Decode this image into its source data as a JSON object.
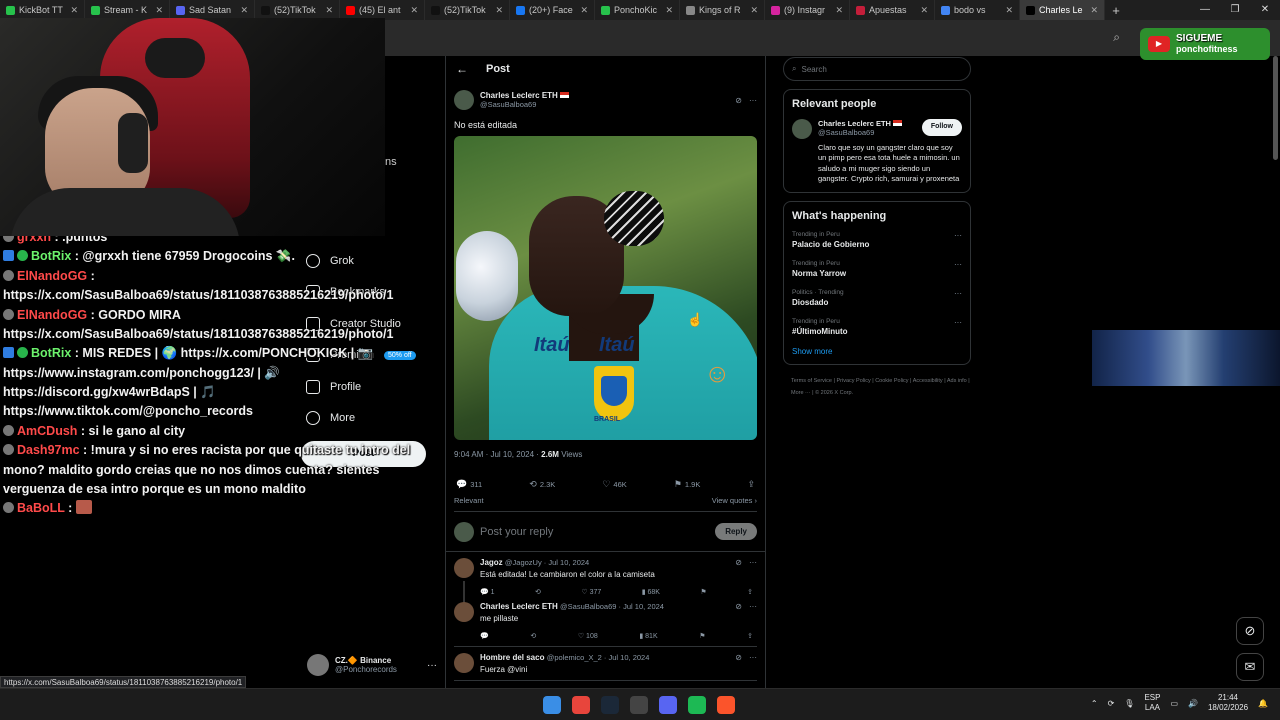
{
  "browser": {
    "tabs": [
      {
        "label": "KickBot TT",
        "color": "#27c24c"
      },
      {
        "label": "Stream - K",
        "color": "#27c24c"
      },
      {
        "label": "Sad Satan",
        "color": "#5865f2"
      },
      {
        "label": "(52)TikTok",
        "color": "#111111"
      },
      {
        "label": "(45) El ant",
        "color": "#ff0000"
      },
      {
        "label": "(52)TikTok",
        "color": "#111111"
      },
      {
        "label": "(20+) Face",
        "color": "#1877f2"
      },
      {
        "label": "PonchoKic",
        "color": "#27c24c"
      },
      {
        "label": "Kings of R",
        "color": "#888888"
      },
      {
        "label": "(9) Instagr",
        "color": "#d6249f"
      },
      {
        "label": "Apuestas",
        "color": "#c41e3a"
      },
      {
        "label": "bodo vs",
        "color": "#4285f4"
      },
      {
        "label": "Charles Le",
        "color": "#000000",
        "active": true
      }
    ],
    "new_tab": "+",
    "window_controls": [
      "—",
      "❐",
      "✕"
    ],
    "status_url": "https://x.com/SasuBalboa69/status/1811038763885216219/photo/1"
  },
  "webcam": {
    "bg_text": "ns"
  },
  "chat": {
    "messages": [
      {
        "user": "grxxh",
        "text": ": .puntos",
        "user_color": "red"
      },
      {
        "user": "BotRix",
        "text": ": @grxxh tiene 67959 Drogocoins 💸.",
        "user_color": "green"
      },
      {
        "user": "ElNandoGG",
        "text": ": https://x.com/SasuBalboa69/status/1811038763885216219/photo/1",
        "user_color": "red"
      },
      {
        "user": "ElNandoGG",
        "text": ": GORDO MIRA https://x.com/SasuBalboa69/status/1811038763885216219/photo/1",
        "user_color": "red"
      },
      {
        "user": "BotRix",
        "text": ": MIS REDES | 🌍 https://x.com/PONCHOKICK | 📷 https://www.instagram.com/ponchogg123/ | 🔊 https://discord.gg/xw4wrBdapS | 🎵 https://www.tiktok.com/@poncho_records",
        "user_color": "green"
      },
      {
        "user": "AmCDush",
        "text": ": si le gano al city",
        "user_color": "red"
      },
      {
        "user": "Dash97mc",
        "text": ": !mura y si no eres racista por que quitaste tu intro del mono? maldito gordo creias que no nos dimos cuenta? sientes verguenza de esa intro porque es un mono maldito",
        "user_color": "red"
      },
      {
        "user": "BaBoLL",
        "text": ":",
        "user_color": "red"
      }
    ]
  },
  "xnav": {
    "items": [
      {
        "label": "Grok",
        "icon": "grok-icon"
      },
      {
        "label": "Bookmarks",
        "icon": "bookmark-icon"
      },
      {
        "label": "Creator Studio",
        "icon": "flask-icon"
      },
      {
        "label": "Premium",
        "icon": "x-logo-icon",
        "pill": "50% off"
      },
      {
        "label": "Profile",
        "icon": "profile-icon"
      },
      {
        "label": "More",
        "icon": "more-circle-icon"
      }
    ],
    "post_button": "Post",
    "account": {
      "name": "CZ.🔶 Binance",
      "handle": "@Ponchorecords",
      "more": "···"
    }
  },
  "post": {
    "header_title": "Post",
    "author": {
      "name": "Charles Leclerc ETH",
      "handle": "@SasuBalboa69"
    },
    "text": "No está editada",
    "photo": {
      "sponsor": "Itaú",
      "country": "BRASIL"
    },
    "timestamp": "9:04 AM · Jul 10, 2024 ·",
    "views_count": "2.6M",
    "views_label": "Views",
    "replies": "311",
    "reposts": "2.3K",
    "likes": "46K",
    "bookmarks": "1.9K",
    "relevant_label": "Relevant",
    "view_quotes": "View quotes ›",
    "reply_placeholder": "Post your reply",
    "reply_button": "Reply"
  },
  "replies": [
    {
      "name": "Jagoz",
      "sub": "@JagozUy · Jul 10, 2024",
      "text": "Está editada! Le cambiaron el color a la camiseta",
      "replies": "1",
      "reposts": "",
      "likes": "377",
      "views": "68K"
    },
    {
      "name": "Charles Leclerc ETH",
      "sub": "@SasuBalboa69 · Jul 10, 2024",
      "text": "me pillaste",
      "replies": "",
      "reposts": "",
      "likes": "108",
      "views": "81K"
    },
    {
      "name": "Hombre del saco",
      "sub": "@polemico_X_2 · Jul 10, 2024",
      "text": "Fuerza @vini",
      "replies": "",
      "reposts": "",
      "likes": "",
      "views": ""
    }
  ],
  "right": {
    "search_placeholder": "Search",
    "relevant_title": "Relevant people",
    "person": {
      "name": "Charles Leclerc ETH",
      "handle": "@SasuBalboa69",
      "follow": "Follow",
      "bio": "Claro que soy un gangster claro que soy un pimp pero esa tota huele a mimosin. un saludo a mi muger sigo siendo un gangster. Crypto rich, samurai y proxeneta"
    },
    "happening_title": "What's happening",
    "trends": [
      {
        "context": "Trending in Peru",
        "title": "Palacio de Gobierno"
      },
      {
        "context": "Trending in Peru",
        "title": "Norma Yarrow"
      },
      {
        "context": "Politics · Trending",
        "title": "Diosdado"
      },
      {
        "context": "Trending in Peru",
        "title": "#ÚltimoMinuto"
      }
    ],
    "show_more": "Show more",
    "footer": [
      "Terms of Service",
      "Privacy Policy",
      "Cookie Policy",
      "Accessibility",
      "Ads info",
      "More ···",
      "© 2026 X Corp."
    ]
  },
  "overlay": {
    "sigueme_title": "SIGUEME",
    "sigueme_handle": "ponchofitness"
  },
  "taskbar": {
    "icons": [
      {
        "name": "windows-start-icon",
        "color": "#3a8ee6"
      },
      {
        "name": "chrome-icon",
        "color": "#e8453c"
      },
      {
        "name": "steam-icon",
        "color": "#1b2838"
      },
      {
        "name": "obs-icon",
        "color": "#444444"
      },
      {
        "name": "discord-icon",
        "color": "#5865f2"
      },
      {
        "name": "spotify-icon",
        "color": "#1db954"
      },
      {
        "name": "brave-icon",
        "color": "#fb542b"
      }
    ],
    "lang_top": "ESP",
    "lang_bottom": "LAA",
    "time": "21:44",
    "date": "18/02/2026"
  }
}
